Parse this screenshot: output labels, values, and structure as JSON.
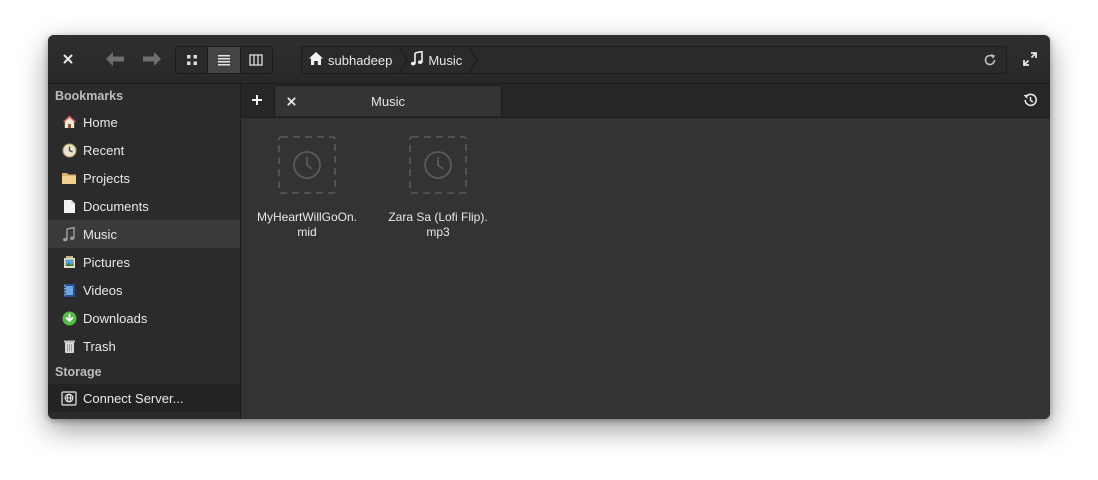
{
  "toolbar": {
    "views": [
      {
        "icon": "grid-view-icon",
        "active": false
      },
      {
        "icon": "list-view-icon",
        "active": true
      },
      {
        "icon": "column-view-icon",
        "active": false
      }
    ]
  },
  "pathbar": {
    "crumbs": [
      {
        "label": "subhadeep",
        "icon": "home-icon"
      },
      {
        "label": "Music",
        "icon": "music-note-icon"
      }
    ]
  },
  "sidebar": {
    "bookmarks_heading": "Bookmarks",
    "items": [
      {
        "label": "Home",
        "icon": "home-icon"
      },
      {
        "label": "Recent",
        "icon": "clock-icon"
      },
      {
        "label": "Projects",
        "icon": "folder-icon"
      },
      {
        "label": "Documents",
        "icon": "document-icon"
      },
      {
        "label": "Music",
        "icon": "music-note-icon",
        "selected": true
      },
      {
        "label": "Pictures",
        "icon": "pictures-icon"
      },
      {
        "label": "Videos",
        "icon": "video-icon"
      },
      {
        "label": "Downloads",
        "icon": "download-icon"
      },
      {
        "label": "Trash",
        "icon": "trash-icon"
      }
    ],
    "storage_heading": "Storage",
    "connect_server": "Connect Server..."
  },
  "tabs": [
    {
      "label": "Music"
    }
  ],
  "files": [
    {
      "name": "MyHeartWillGoOn.mid",
      "icon": "pending-thumbnail-icon"
    },
    {
      "name": "Zara Sa (Lofi Flip).mp3",
      "icon": "pending-thumbnail-icon"
    }
  ],
  "colors": {
    "window_bg": "#333333",
    "sidebar_bg": "#2b2b2b",
    "text": "#e8e8e8",
    "download_green": "#55b947",
    "home_red": "#d9534f"
  }
}
